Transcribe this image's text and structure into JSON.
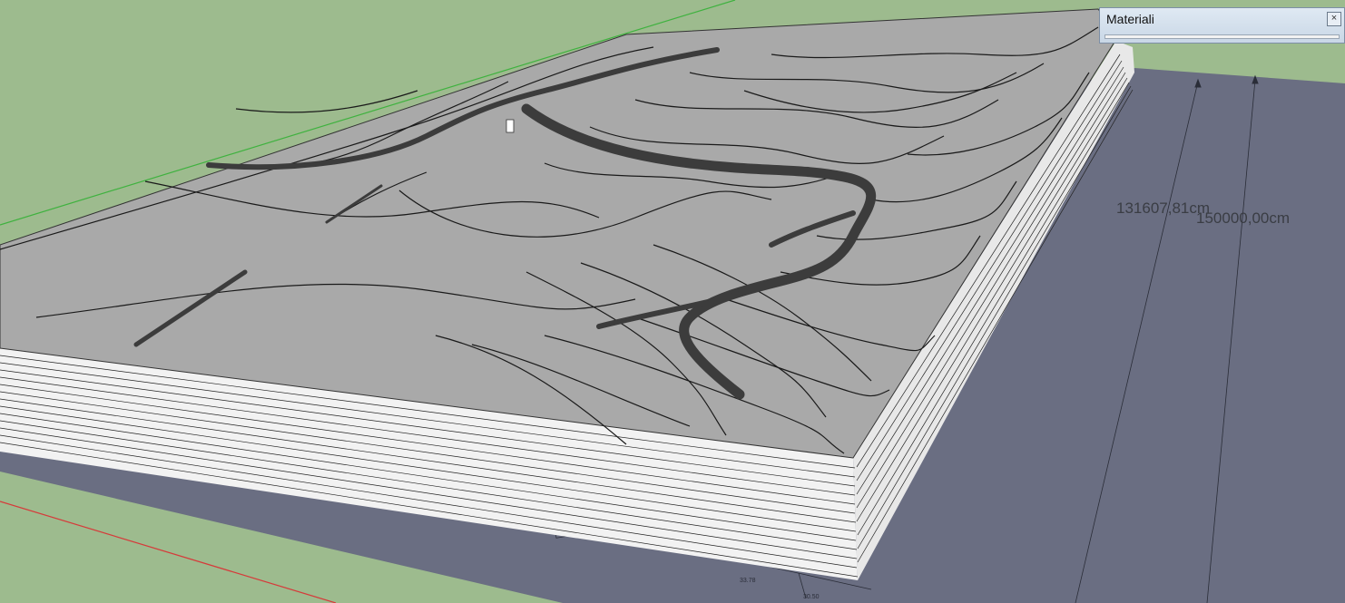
{
  "dimensions": {
    "measure_a": "131607,81cm",
    "measure_b": "150000,00cm"
  },
  "materials_panel": {
    "title": "Materiali",
    "close_glyph": "×"
  },
  "colors": {
    "ground": "#9dbb8e",
    "base_plane": "#6a6e82",
    "terrain_top": "#a9a9a9",
    "terrain_side": "#f0f0f0",
    "road": "#3c3c3c",
    "green_axis": "#3fb23f",
    "red_axis": "#d63a3a"
  },
  "icons": [
    "close-icon"
  ]
}
